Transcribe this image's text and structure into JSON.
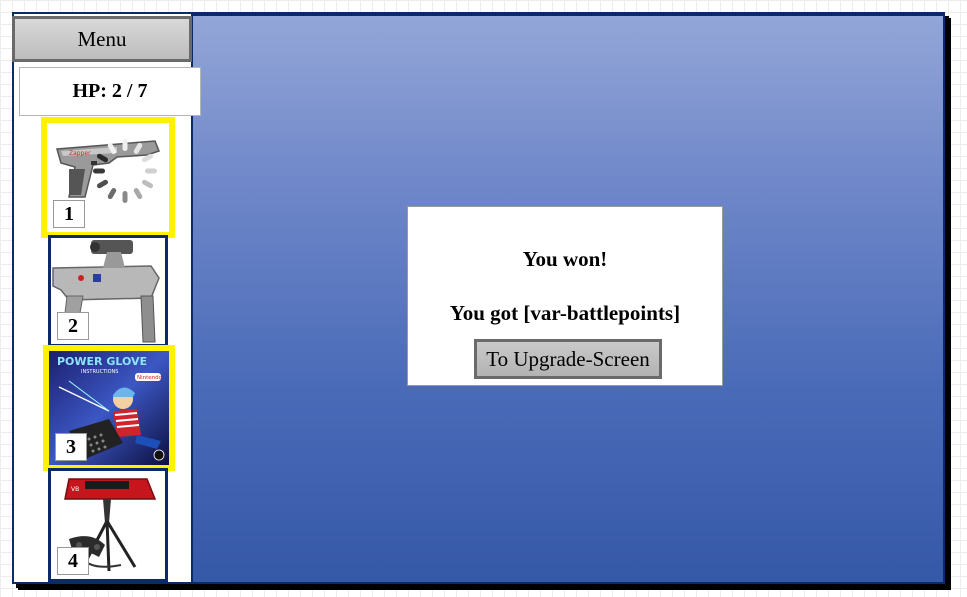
{
  "sidebar": {
    "menu_label": "Menu",
    "hp_label": "HP: 2 / 7",
    "cards": [
      {
        "number": "1",
        "item": "light-gun",
        "state": "selected, loading"
      },
      {
        "number": "2",
        "item": "super-scope",
        "state": "available"
      },
      {
        "number": "3",
        "item": "power-glove",
        "state": "selected"
      },
      {
        "number": "4",
        "item": "virtual-boy",
        "state": "available"
      }
    ],
    "power_glove_box_title": "POWER GLOVE",
    "power_glove_box_subtitle": "INSTRUCTIONS",
    "nintendo_logo": "Nintendo"
  },
  "dialog": {
    "title": "You won!",
    "reward": "You got [var-battlepoints]",
    "button_label": "To Upgrade-Screen"
  },
  "colors": {
    "selected_border": "#fff200",
    "card_border": "#0b2a6b",
    "battle_top": "#93a6d8",
    "battle_bottom": "#3558a7"
  }
}
